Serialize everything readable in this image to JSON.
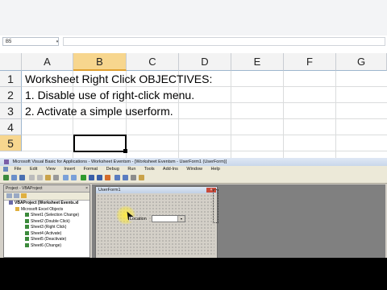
{
  "excel": {
    "name_box": "B5",
    "name_box_arrow": "▾",
    "columns": [
      "A",
      "B",
      "C",
      "D",
      "E",
      "F",
      "G"
    ],
    "selected_column": "B",
    "rows": [
      "1",
      "2",
      "3",
      "4",
      "5"
    ],
    "selected_row": "5",
    "cells": {
      "A1": "Worksheet Right Click OBJECTIVES:",
      "A2": "1. Disable use of right-click menu.",
      "A3": "2. Activate a simple userform."
    }
  },
  "vbe": {
    "title": "Microsoft Visual Basic for Applications - Worksheet Eventsm - [Worksheet Eventsm - UserForm1 (UserForm)]",
    "menu": [
      "File",
      "Edit",
      "View",
      "Insert",
      "Format",
      "Debug",
      "Run",
      "Tools",
      "Add-Ins",
      "Window",
      "Help"
    ],
    "project_panel": {
      "title": "Project - VBAProject",
      "close": "×",
      "tree": [
        {
          "level": 0,
          "label": "VBAProject (Worksheet Events.xl"
        },
        {
          "level": 1,
          "label": "Microsoft Excel Objects"
        },
        {
          "level": 2,
          "label": "Sheet1 (Selection Change)"
        },
        {
          "level": 2,
          "label": "Sheet2 (Double Click)"
        },
        {
          "level": 2,
          "label": "Sheet3 (Right Click)"
        },
        {
          "level": 2,
          "label": "Sheet4 (Activate)"
        },
        {
          "level": 2,
          "label": "Sheet5 (Deactivate)"
        },
        {
          "level": 2,
          "label": "Sheet6 (Change)"
        }
      ]
    },
    "userform": {
      "title": "UserForm1",
      "close": "×",
      "label": "Location",
      "combo_arrow": "▾"
    }
  },
  "colors": {
    "selected_header": "#f7d68e",
    "vbe_face": "#d4d0c8",
    "title_gradient_top": "#dde7f4"
  }
}
